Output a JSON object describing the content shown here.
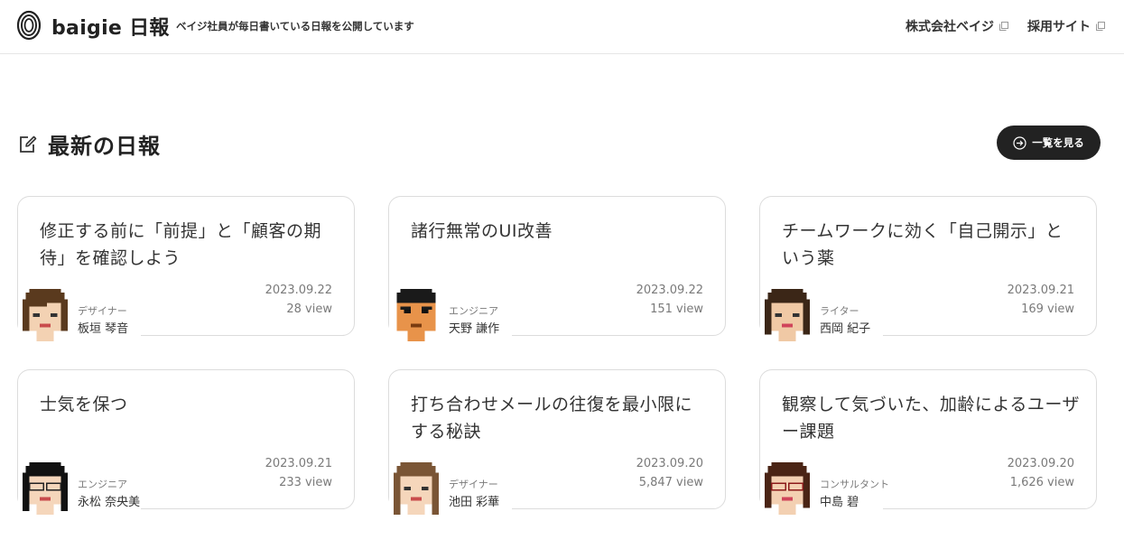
{
  "header": {
    "brand": "baigie 日報",
    "tagline": "ベイジ社員が毎日書いている日報を公開しています",
    "nav": [
      {
        "label": "株式会社ベイジ"
      },
      {
        "label": "採用サイト"
      }
    ]
  },
  "section": {
    "title": "最新の日報",
    "list_button": "一覧を見る"
  },
  "cards": [
    {
      "title": "修正する前に「前提」と「顧客の期待」を確認しよう",
      "date": "2023.09.22",
      "views": "28 view",
      "role": "デザイナー",
      "name": "板垣 琴音"
    },
    {
      "title": "諸行無常のUI改善",
      "date": "2023.09.22",
      "views": "151 view",
      "role": "エンジニア",
      "name": "天野 謙作"
    },
    {
      "title": "チームワークに効く「自己開示」という薬",
      "date": "2023.09.21",
      "views": "169 view",
      "role": "ライター",
      "name": "西岡 紀子"
    },
    {
      "title": "士気を保つ",
      "date": "2023.09.21",
      "views": "233 view",
      "role": "エンジニア",
      "name": "永松 奈央美"
    },
    {
      "title": "打ち合わせメールの往復を最小限にする秘訣",
      "date": "2023.09.20",
      "views": "5,847 view",
      "role": "デザイナー",
      "name": "池田 彩華"
    },
    {
      "title": "観察して気づいた、加齢によるユーザー課題",
      "date": "2023.09.20",
      "views": "1,626 view",
      "role": "コンサルタント",
      "name": "中島 碧"
    }
  ]
}
